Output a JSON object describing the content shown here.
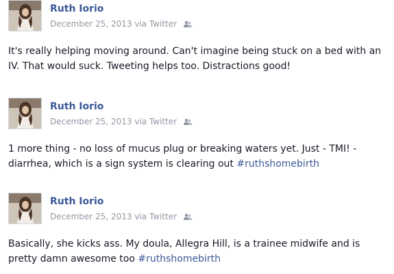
{
  "posts": [
    {
      "author": "Ruth Iorio",
      "date": "December 25, 2013",
      "via": "via Twitter",
      "audience_icon": "friends-icon",
      "text": "It's really helping moving around. Can't imagine being stuck on a bed with an IV. That would suck. Tweeting helps too. Distractions good!",
      "hashtag": ""
    },
    {
      "author": "Ruth Iorio",
      "date": "December 25, 2013",
      "via": "via Twitter",
      "audience_icon": "friends-icon",
      "text": "1 more thing - no loss of mucus plug or breaking waters yet. Just - TMI! - diarrhea, which is a sign system is clearing out",
      "hashtag": "#ruthshomebirth"
    },
    {
      "author": "Ruth Iorio",
      "date": "December 25, 2013",
      "via": "via Twitter",
      "audience_icon": "friends-icon",
      "text": "Basically, she kicks ass. My doula, Allegra Hill, is a trainee midwife and is pretty damn awesome too",
      "hashtag": "#ruthshomebirth"
    }
  ],
  "colors": {
    "name": "#3b5998",
    "meta": "#9197a3",
    "text": "#141823",
    "hashtag": "#3b5998"
  }
}
